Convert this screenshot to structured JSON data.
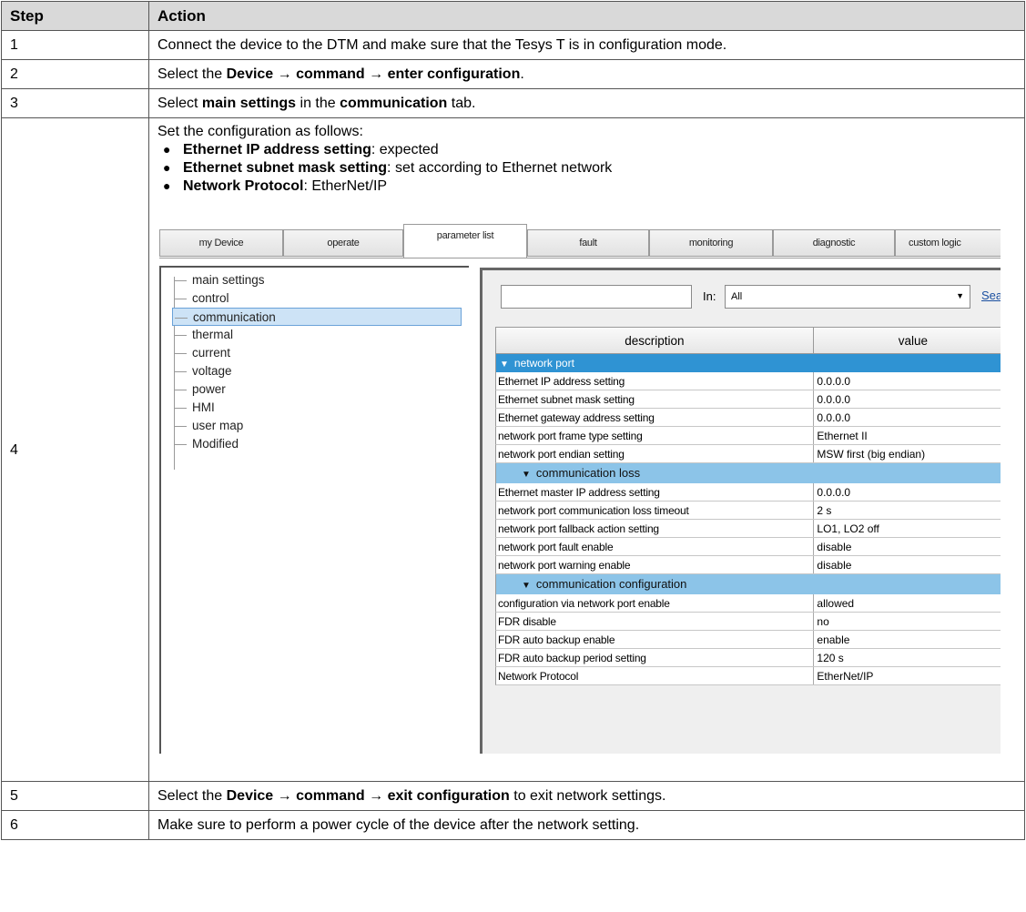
{
  "table": {
    "header_step": "Step",
    "header_action": "Action",
    "rows": [
      {
        "step": "1",
        "text": "Connect the device to the DTM and make sure that the Tesys T is in configuration mode."
      },
      {
        "step": "2",
        "pre": "Select the ",
        "b1": "Device",
        "arrow1": " → ",
        "b2": "command",
        "arrow2": " → ",
        "b3": "enter configuration",
        "post": "."
      },
      {
        "step": "3",
        "pre": "Select ",
        "b1": "main settings",
        "mid": " in the ",
        "b2": "communication",
        "post": " tab."
      },
      {
        "step": "4",
        "intro": "Set the configuration as follows:",
        "bullets": [
          {
            "b": "Ethernet IP address setting",
            "t": ": expected"
          },
          {
            "b": "Ethernet subnet mask setting",
            "t": ": set according to Ethernet network"
          },
          {
            "b": "Network Protocol",
            "t": ": EtherNet/IP"
          }
        ]
      },
      {
        "step": "5",
        "pre": "Select the ",
        "b1": "Device",
        "arrow1": " → ",
        "b2": "command",
        "arrow2": " → ",
        "b3": "exit configuration",
        "post": " to exit network settings."
      },
      {
        "step": "6",
        "text": "Make sure to perform a power cycle of the device after the network setting."
      }
    ]
  },
  "screenshot": {
    "tabs": [
      "my Device",
      "operate",
      "parameter list",
      "fault",
      "monitoring",
      "diagnostic",
      "custom logic"
    ],
    "active_tab": "parameter list",
    "tree": [
      "main settings",
      "control",
      "communication",
      "thermal",
      "current",
      "voltage",
      "power",
      "HMI",
      "user map",
      "Modified"
    ],
    "selected_tree_item": "communication",
    "search_value": "",
    "in_label": "In:",
    "filter_value": "All",
    "search_link": "Sea",
    "col_description": "description",
    "col_value": "value",
    "group_network_port": "network port",
    "group_comm_loss": "communication loss",
    "group_comm_config": "communication configuration",
    "params_network_port": [
      {
        "d": "Ethernet IP address setting",
        "v": "0.0.0.0"
      },
      {
        "d": "Ethernet subnet mask setting",
        "v": "0.0.0.0"
      },
      {
        "d": "Ethernet gateway address setting",
        "v": "0.0.0.0"
      },
      {
        "d": "network port frame type setting",
        "v": "Ethernet II"
      },
      {
        "d": "network port endian setting",
        "v": "MSW first (big endian)"
      }
    ],
    "params_comm_loss": [
      {
        "d": "Ethernet master IP address setting",
        "v": "0.0.0.0"
      },
      {
        "d": "network port communication loss timeout",
        "v": "2 s"
      },
      {
        "d": "network port fallback action setting",
        "v": "LO1, LO2 off"
      },
      {
        "d": "network port fault enable",
        "v": "disable"
      },
      {
        "d": "network port warning enable",
        "v": "disable"
      }
    ],
    "params_comm_config": [
      {
        "d": "configuration via network port enable",
        "v": "allowed"
      },
      {
        "d": "FDR disable",
        "v": "no"
      },
      {
        "d": "FDR auto backup enable",
        "v": "enable"
      },
      {
        "d": "FDR auto backup period setting",
        "v": "120 s"
      },
      {
        "d": "Network Protocol",
        "v": "EtherNet/IP"
      }
    ]
  }
}
